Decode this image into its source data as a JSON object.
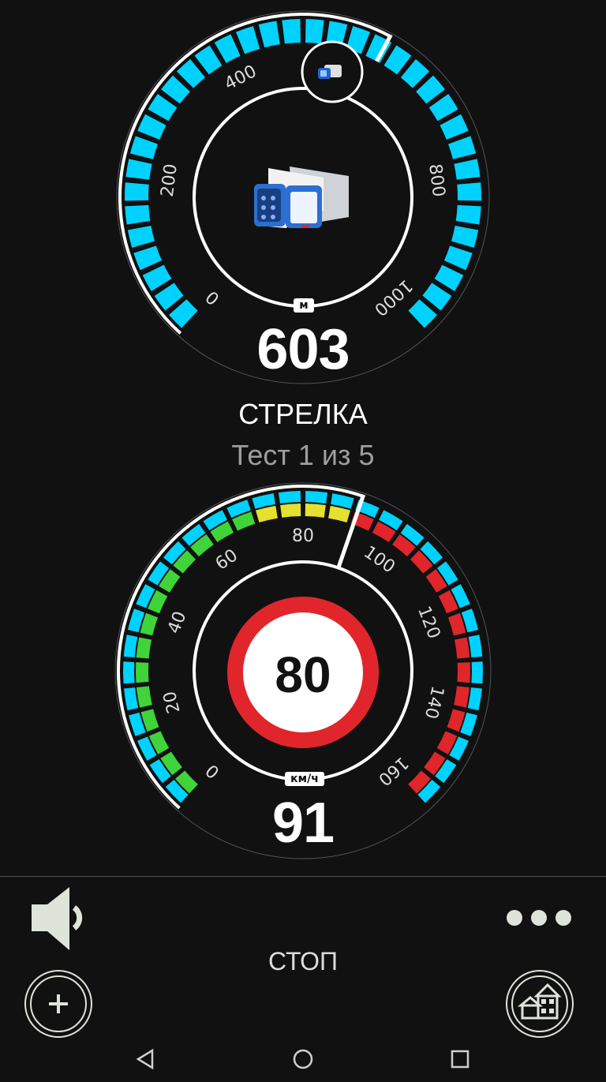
{
  "distance_gauge": {
    "value": "603",
    "unit": "м",
    "scale_labels": [
      "0",
      "200",
      "400",
      "800",
      "1000"
    ],
    "scale_min": 0,
    "scale_max": 1000,
    "progress_value": 603,
    "colors": {
      "fill": "#00d2ff",
      "ring": "#ffffff"
    },
    "icon": "radar-detector-icon",
    "marker_icon": "car-icon"
  },
  "mode": {
    "title": "СТРЕЛКА",
    "subtitle": "Тест 1 из 5"
  },
  "speed_gauge": {
    "value": "91",
    "unit": "км/ч",
    "scale_labels": [
      "0",
      "20",
      "40",
      "60",
      "80",
      "100",
      "120",
      "140",
      "160"
    ],
    "speed_limit": "80",
    "colors": {
      "green": "#3fd43a",
      "yellow": "#e6e02e",
      "red": "#e0262b",
      "cyan": "#00d2ff"
    },
    "icon": "speed-limit-sign-icon"
  },
  "controls": {
    "stop_label": "СТОП",
    "sound_icon": "speaker-icon",
    "more_icon": "more-dots-icon",
    "add_icon": "add-icon",
    "home_icon": "home-zone-icon"
  },
  "navbar": {
    "back_icon": "back-triangle-icon",
    "home_icon": "home-circle-icon",
    "recents_icon": "recents-square-icon"
  }
}
